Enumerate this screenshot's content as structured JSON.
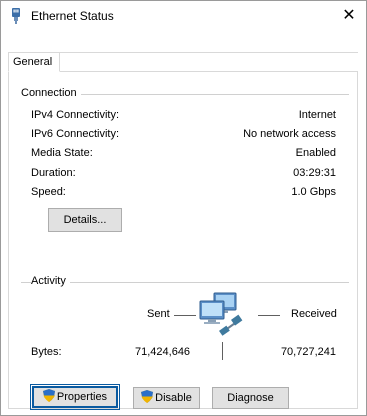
{
  "window": {
    "title": "Ethernet Status",
    "close_glyph": "✕",
    "icon": "ethernet-icon"
  },
  "tabs": [
    {
      "label": "General",
      "selected": true
    }
  ],
  "connection": {
    "group_label": "Connection",
    "rows": [
      {
        "label": "IPv4 Connectivity:",
        "value": "Internet"
      },
      {
        "label": "IPv6 Connectivity:",
        "value": "No network access"
      },
      {
        "label": "Media State:",
        "value": "Enabled"
      },
      {
        "label": "Duration:",
        "value": "03:29:31"
      },
      {
        "label": "Speed:",
        "value": "1.0 Gbps"
      }
    ],
    "details_button": "Details..."
  },
  "activity": {
    "group_label": "Activity",
    "sent_label": "Sent",
    "received_label": "Received",
    "bytes_label": "Bytes:",
    "bytes_sent": "71,424,646",
    "bytes_received": "70,727,241",
    "icon": "network-computers-icon"
  },
  "buttons": {
    "properties": "Properties",
    "disable": "Disable",
    "diagnose": "Diagnose"
  },
  "colors": {
    "focus_border": "#0a5aa0",
    "button_face": "#e1e1e1",
    "group_line": "#d0d0d0"
  }
}
